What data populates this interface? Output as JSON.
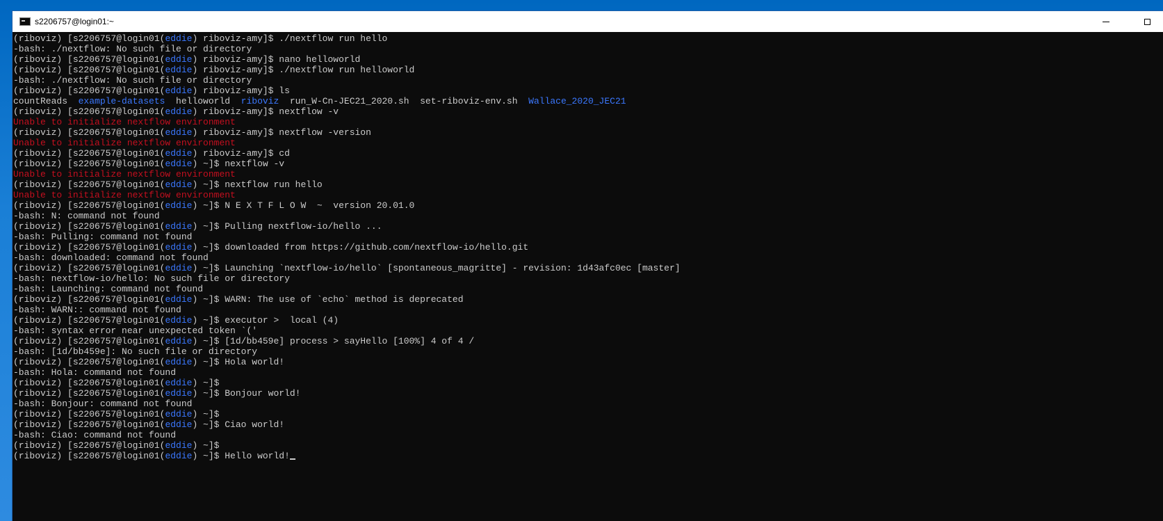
{
  "window": {
    "title": "s2206757@login01:~"
  },
  "terminal": {
    "colors": {
      "default": "#cccccc",
      "user": "#3b78ff",
      "dir": "#3b78ff",
      "error": "#c50f1f",
      "background": "#0c0c0c"
    },
    "lines": [
      [
        {
          "t": "(riboviz) [s2206757@login01("
        },
        {
          "t": "eddie",
          "c": "user"
        },
        {
          "t": ") riboviz-amy]$ ./nextflow run hello"
        }
      ],
      [
        {
          "t": "-bash: ./nextflow: No such file or directory"
        }
      ],
      [
        {
          "t": "(riboviz) [s2206757@login01("
        },
        {
          "t": "eddie",
          "c": "user"
        },
        {
          "t": ") riboviz-amy]$ nano helloworld"
        }
      ],
      [
        {
          "t": "(riboviz) [s2206757@login01("
        },
        {
          "t": "eddie",
          "c": "user"
        },
        {
          "t": ") riboviz-amy]$ ./nextflow run helloworld"
        }
      ],
      [
        {
          "t": "-bash: ./nextflow: No such file or directory"
        }
      ],
      [
        {
          "t": "(riboviz) [s2206757@login01("
        },
        {
          "t": "eddie",
          "c": "user"
        },
        {
          "t": ") riboviz-amy]$ ls"
        }
      ],
      [
        {
          "t": "countReads  "
        },
        {
          "t": "example-datasets",
          "c": "dir"
        },
        {
          "t": "  helloworld  "
        },
        {
          "t": "riboviz",
          "c": "dir"
        },
        {
          "t": "  run_W-Cn-JEC21_2020.sh  set-riboviz-env.sh  "
        },
        {
          "t": "Wallace_2020_JEC21",
          "c": "dir"
        }
      ],
      [
        {
          "t": "(riboviz) [s2206757@login01("
        },
        {
          "t": "eddie",
          "c": "user"
        },
        {
          "t": ") riboviz-amy]$ nextflow -v"
        }
      ],
      [
        {
          "t": "Unable to initialize nextflow environment",
          "c": "error"
        }
      ],
      [
        {
          "t": "(riboviz) [s2206757@login01("
        },
        {
          "t": "eddie",
          "c": "user"
        },
        {
          "t": ") riboviz-amy]$ nextflow -version"
        }
      ],
      [
        {
          "t": "Unable to initialize nextflow environment",
          "c": "error"
        }
      ],
      [
        {
          "t": "(riboviz) [s2206757@login01("
        },
        {
          "t": "eddie",
          "c": "user"
        },
        {
          "t": ") riboviz-amy]$ cd"
        }
      ],
      [
        {
          "t": "(riboviz) [s2206757@login01("
        },
        {
          "t": "eddie",
          "c": "user"
        },
        {
          "t": ") ~]$ nextflow -v"
        }
      ],
      [
        {
          "t": "Unable to initialize nextflow environment",
          "c": "error"
        }
      ],
      [
        {
          "t": "(riboviz) [s2206757@login01("
        },
        {
          "t": "eddie",
          "c": "user"
        },
        {
          "t": ") ~]$ nextflow run hello"
        }
      ],
      [
        {
          "t": "Unable to initialize nextflow environment",
          "c": "error"
        }
      ],
      [
        {
          "t": "(riboviz) [s2206757@login01("
        },
        {
          "t": "eddie",
          "c": "user"
        },
        {
          "t": ") ~]$ N E X T F L O W  ~  version 20.01.0"
        }
      ],
      [
        {
          "t": "-bash: N: command not found"
        }
      ],
      [
        {
          "t": "(riboviz) [s2206757@login01("
        },
        {
          "t": "eddie",
          "c": "user"
        },
        {
          "t": ") ~]$ Pulling nextflow-io/hello ..."
        }
      ],
      [
        {
          "t": "-bash: Pulling: command not found"
        }
      ],
      [
        {
          "t": "(riboviz) [s2206757@login01("
        },
        {
          "t": "eddie",
          "c": "user"
        },
        {
          "t": ") ~]$ downloaded from https://github.com/nextflow-io/hello.git"
        }
      ],
      [
        {
          "t": "-bash: downloaded: command not found"
        }
      ],
      [
        {
          "t": "(riboviz) [s2206757@login01("
        },
        {
          "t": "eddie",
          "c": "user"
        },
        {
          "t": ") ~]$ Launching `nextflow-io/hello` [spontaneous_magritte] - revision: 1d43afc0ec [master]"
        }
      ],
      [
        {
          "t": "-bash: nextflow-io/hello: No such file or directory"
        }
      ],
      [
        {
          "t": "-bash: Launching: command not found"
        }
      ],
      [
        {
          "t": "(riboviz) [s2206757@login01("
        },
        {
          "t": "eddie",
          "c": "user"
        },
        {
          "t": ") ~]$ WARN: The use of `echo` method is deprecated"
        }
      ],
      [
        {
          "t": "-bash: WARN:: command not found"
        }
      ],
      [
        {
          "t": "(riboviz) [s2206757@login01("
        },
        {
          "t": "eddie",
          "c": "user"
        },
        {
          "t": ") ~]$ executor >  local (4)"
        }
      ],
      [
        {
          "t": "-bash: syntax error near unexpected token `('"
        }
      ],
      [
        {
          "t": "(riboviz) [s2206757@login01("
        },
        {
          "t": "eddie",
          "c": "user"
        },
        {
          "t": ") ~]$ [1d/bb459e] process > sayHello [100%] 4 of 4 /"
        }
      ],
      [
        {
          "t": "-bash: [1d/bb459e]: No such file or directory"
        }
      ],
      [
        {
          "t": "(riboviz) [s2206757@login01("
        },
        {
          "t": "eddie",
          "c": "user"
        },
        {
          "t": ") ~]$ Hola world!"
        }
      ],
      [
        {
          "t": "-bash: Hola: command not found"
        }
      ],
      [
        {
          "t": "(riboviz) [s2206757@login01("
        },
        {
          "t": "eddie",
          "c": "user"
        },
        {
          "t": ") ~]$"
        }
      ],
      [
        {
          "t": "(riboviz) [s2206757@login01("
        },
        {
          "t": "eddie",
          "c": "user"
        },
        {
          "t": ") ~]$ Bonjour world!"
        }
      ],
      [
        {
          "t": "-bash: Bonjour: command not found"
        }
      ],
      [
        {
          "t": "(riboviz) [s2206757@login01("
        },
        {
          "t": "eddie",
          "c": "user"
        },
        {
          "t": ") ~]$"
        }
      ],
      [
        {
          "t": "(riboviz) [s2206757@login01("
        },
        {
          "t": "eddie",
          "c": "user"
        },
        {
          "t": ") ~]$ Ciao world!"
        }
      ],
      [
        {
          "t": "-bash: Ciao: command not found"
        }
      ],
      [
        {
          "t": "(riboviz) [s2206757@login01("
        },
        {
          "t": "eddie",
          "c": "user"
        },
        {
          "t": ") ~]$"
        }
      ],
      [
        {
          "t": "(riboviz) [s2206757@login01("
        },
        {
          "t": "eddie",
          "c": "user"
        },
        {
          "t": ") ~]$ Hello world!"
        }
      ]
    ]
  }
}
